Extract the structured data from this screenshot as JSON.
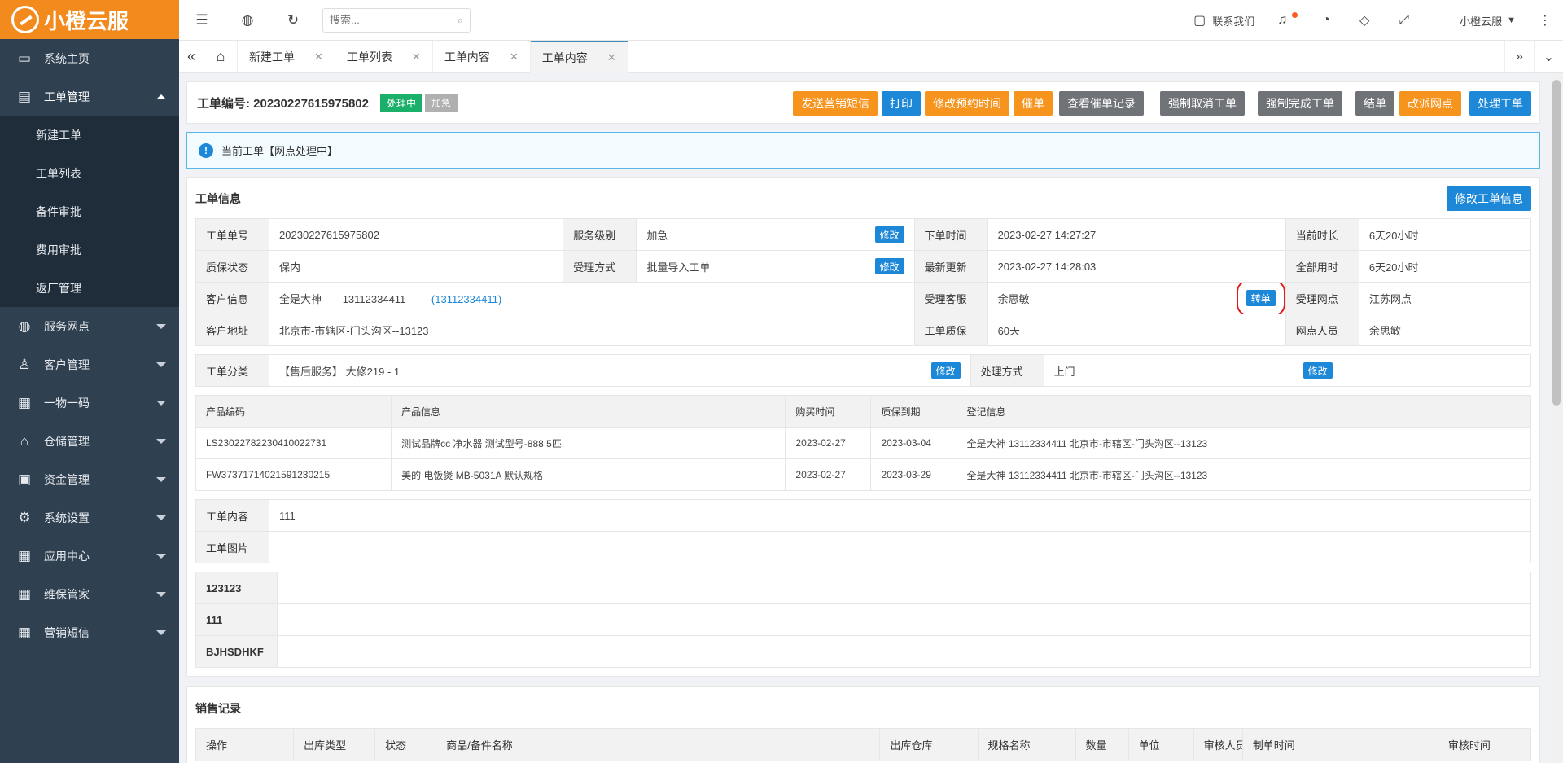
{
  "brand": {
    "name": "小橙云服"
  },
  "sidebar": {
    "items": [
      {
        "label": "系统主页",
        "icon": "monitor-icon"
      },
      {
        "label": "工单管理",
        "icon": "document-icon"
      },
      {
        "label": "服务网点",
        "icon": "globe-icon"
      },
      {
        "label": "客户管理",
        "icon": "user-icon"
      },
      {
        "label": "一物一码",
        "icon": "grid-icon"
      },
      {
        "label": "仓储管理",
        "icon": "bank-icon"
      },
      {
        "label": "资金管理",
        "icon": "money-icon"
      },
      {
        "label": "系统设置",
        "icon": "gear-icon"
      },
      {
        "label": "应用中心",
        "icon": "grid-icon"
      },
      {
        "label": "维保管家",
        "icon": "grid-icon"
      },
      {
        "label": "营销短信",
        "icon": "grid-icon"
      }
    ],
    "submenu": [
      "新建工单",
      "工单列表",
      "备件审批",
      "费用审批",
      "返厂管理"
    ]
  },
  "topbar": {
    "search_placeholder": "搜索...",
    "contact": "联系我们",
    "user": "小橙云服"
  },
  "tabs": [
    "新建工单",
    "工单列表",
    "工单内容",
    "工单内容"
  ],
  "order": {
    "title_label": "工单编号:",
    "number": "20230227615975802",
    "status": "处理中",
    "priority": "加急",
    "actions": [
      "发送营销短信",
      "打印",
      "修改预约时间",
      "催单",
      "查看催单记录",
      "强制取消工单",
      "强制完成工单",
      "结单",
      "改派网点",
      "处理工单"
    ]
  },
  "alert": {
    "text": "当前工单【网点处理中】"
  },
  "info": {
    "title": "工单信息",
    "edit_button": "修改工单信息",
    "modify": "修改",
    "transfer": "转单",
    "labels": {
      "order_no": "工单单号",
      "service_level": "服务级别",
      "order_time": "下单时间",
      "current_duration": "当前时长",
      "warranty_status": "质保状态",
      "accept_method": "受理方式",
      "last_update": "最新更新",
      "total_time": "全部用时",
      "customer_info": "客户信息",
      "accept_service": "受理客服",
      "accept_outlet": "受理网点",
      "customer_address": "客户地址",
      "order_warranty": "工单质保",
      "outlet_staff": "网点人员",
      "category": "工单分类",
      "handle_method": "处理方式"
    },
    "values": {
      "order_no": "20230227615975802",
      "service_level": "加急",
      "order_time": "2023-02-27 14:27:27",
      "current_duration": "6天20小时",
      "warranty_status": "保内",
      "accept_method": "批量导入工单",
      "last_update": "2023-02-27 14:28:03",
      "total_time": "6天20小时",
      "customer_name": "全是大神",
      "customer_phone": "13112334411",
      "customer_phone2": "(13112334411)",
      "accept_service": "余思敏",
      "accept_outlet": "江苏网点",
      "customer_address": "北京市-市辖区-门头沟区--13123",
      "order_warranty": "60天",
      "outlet_staff": "余思敏",
      "category": "【售后服务】 大修219 - 1",
      "handle_method": "上门"
    }
  },
  "products": {
    "headers": [
      "产品编码",
      "产品信息",
      "购买时间",
      "质保到期",
      "登记信息"
    ],
    "rows": [
      [
        "LS23022782230410022731",
        "测试品牌cc 净水器 测试型号-888 5匹",
        "2023-02-27",
        "2023-03-04",
        "全是大神 13112334411 北京市-市辖区-门头沟区--13123"
      ],
      [
        "FW37371714021591230215",
        "美的 电饭煲 MB-5031A 默认规格",
        "2023-02-27",
        "2023-03-29",
        "全是大神 13112334411 北京市-市辖区-门头沟区--13123"
      ]
    ]
  },
  "content": {
    "content_label": "工单内容",
    "content_value": "111",
    "image_label": "工单图片"
  },
  "extra_fields": [
    "123123",
    "111",
    "BJHSDHKF"
  ],
  "sales": {
    "title": "销售记录",
    "headers": [
      "操作",
      "出库类型",
      "状态",
      "商品/备件名称",
      "出库仓库",
      "规格名称",
      "数量",
      "单位",
      "审核人员",
      "制单时间",
      "审核时间"
    ]
  }
}
